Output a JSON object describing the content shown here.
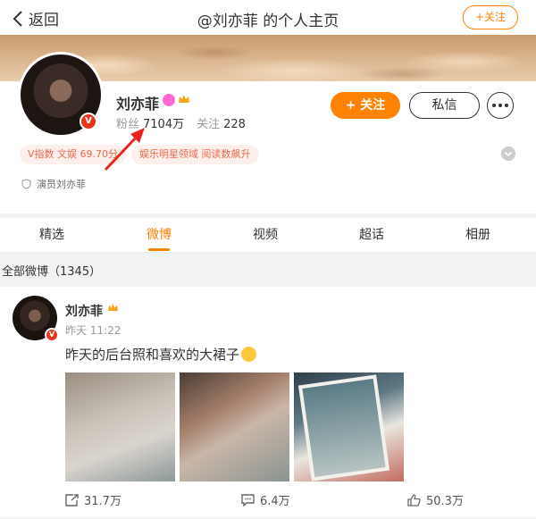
{
  "header": {
    "back_label": "返回",
    "title": "@刘亦菲 的个人主页",
    "follow_label": "+关注"
  },
  "profile": {
    "name": "刘亦菲",
    "fans_label": "粉丝",
    "fans_count": "7104万",
    "following_label": "关注",
    "following_count": "228",
    "follow_button": "+ 关注",
    "message_button": "私信",
    "tags": [
      "V指数 文娱 69.70分",
      "娱乐明星领域 阅读数飙升"
    ],
    "verification": "演员刘亦菲",
    "badge_letter": "V"
  },
  "tabs": [
    "精选",
    "微博",
    "视频",
    "超话",
    "相册"
  ],
  "active_tab": "微博",
  "feed": {
    "section_title": "全部微博（1345）",
    "post": {
      "author": "刘亦菲",
      "time": "昨天 11:22",
      "text": "昨天的后台照和喜欢的大裙子",
      "reposts": "31.7万",
      "comments": "6.4万",
      "likes": "50.3万"
    }
  },
  "colors": {
    "accent": "#ff8200",
    "tag_bg": "#fdf0ec",
    "tag_text": "#e86b4a",
    "verify_badge": "#e8351d",
    "annotation_arrow": "#e8241c"
  }
}
